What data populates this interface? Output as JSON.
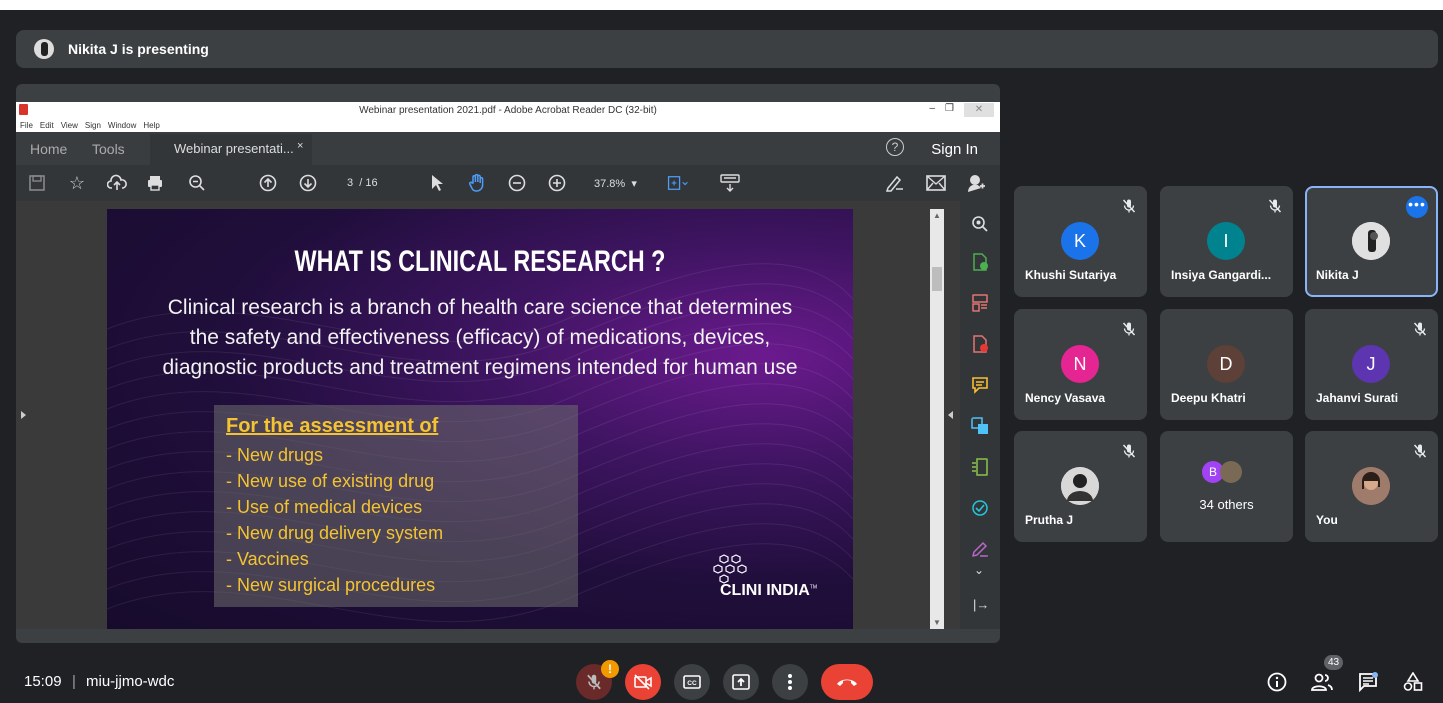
{
  "presenter_bar": {
    "text": "Nikita J is presenting"
  },
  "acrobat": {
    "window_title": "Webinar presentation 2021.pdf - Adobe Acrobat Reader DC (32-bit)",
    "menu": [
      "File",
      "Edit",
      "View",
      "Sign",
      "Window",
      "Help"
    ],
    "tabs": {
      "home": "Home",
      "tools": "Tools",
      "doc_tab": "Webinar presentati...",
      "close": "×"
    },
    "help": "?",
    "sign_in": "Sign In",
    "page_current": "3",
    "page_total": "/ 16",
    "zoom": "37.8%"
  },
  "slide": {
    "title": "WHAT IS CLINICAL RESEARCH ?",
    "paragraph_lines": [
      "Clinical research is a branch of health care science that determines",
      "the safety and effectiveness  (efficacy) of medications, devices,",
      "diagnostic products and treatment regimens intended for human use"
    ],
    "box_heading": "For the assessment of ",
    "box_items": [
      "- New drugs",
      "- New use of existing drug",
      "- Use of medical devices",
      "- New drug delivery system",
      "- Vaccines",
      "- New surgical procedures"
    ],
    "logo_text": "CLINI INDIA",
    "logo_tm": "TM"
  },
  "participants": [
    {
      "name": "Khushi Sutariya",
      "initial": "K",
      "color": "#1a73e8",
      "muted": true
    },
    {
      "name": "Insiya Gangardi...",
      "initial": "I",
      "color": "#00838f",
      "muted": true
    },
    {
      "name": "Nikita J",
      "initial": "",
      "color": "#dddddd",
      "muted": false,
      "selected": true
    },
    {
      "name": "Nency Vasava",
      "initial": "N",
      "color": "#e52592",
      "muted": true
    },
    {
      "name": "Deepu Khatri",
      "initial": "D",
      "color": "#5d4037",
      "muted": false
    },
    {
      "name": "Jahanvi Surati",
      "initial": "J",
      "color": "#5e35b1",
      "muted": true
    },
    {
      "name": "Prutha J",
      "initial": "",
      "color": "#cccccc",
      "muted": true
    },
    {
      "name": "34 others",
      "initial": "B",
      "color": "#a142f4",
      "muted": false
    },
    {
      "name": "You",
      "initial": "",
      "color": "#8d6e63",
      "muted": true
    }
  ],
  "meeting": {
    "time": "15:09",
    "separator": "|",
    "code": "miu-jjmo-wdc",
    "people_count": "43",
    "warning": "!"
  },
  "icons": {
    "mic": "mic-off-icon",
    "camera": "camera-off-icon",
    "captions": "captions-icon",
    "present": "present-icon",
    "more": "more-vert-icon",
    "end_call": "end-call-icon",
    "info": "info-icon",
    "people": "people-icon",
    "chat": "chat-icon",
    "activities": "activities-icon"
  },
  "colors": {
    "meet_bg": "#202124",
    "tile_bg": "#3c4043",
    "accent_blue": "#8ab4f8",
    "end_call_red": "#ea4335",
    "slide_yellow": "#f4c430"
  }
}
